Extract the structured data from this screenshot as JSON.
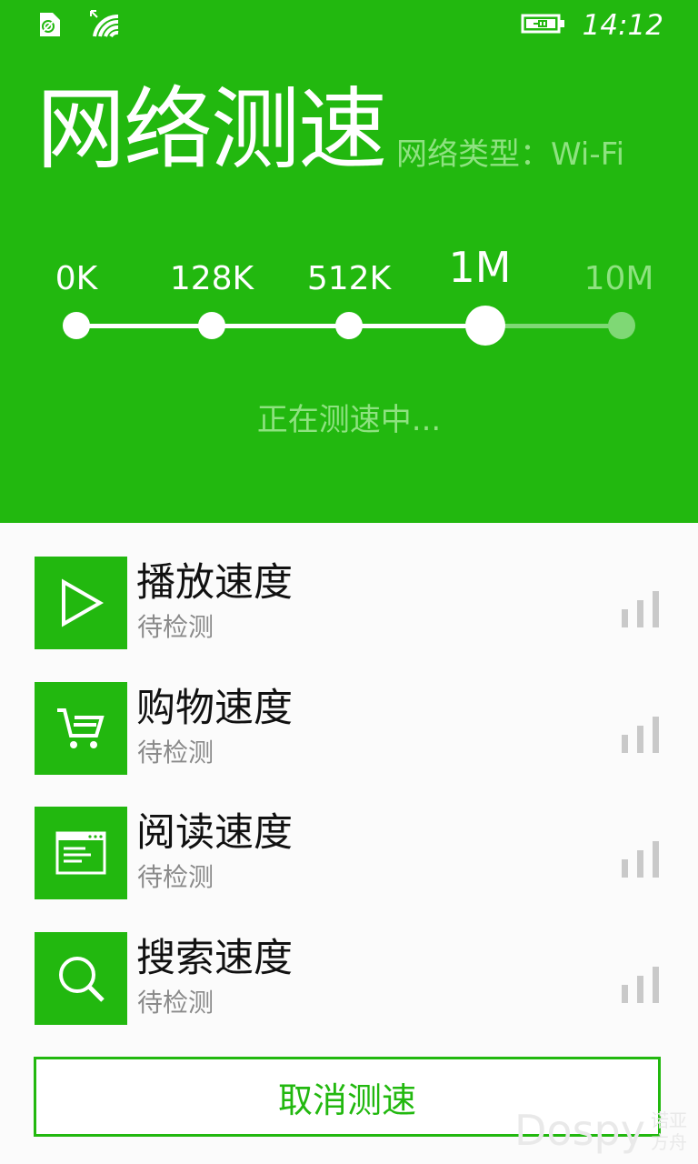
{
  "status_bar": {
    "time": "14:12"
  },
  "header": {
    "title": "网络测速",
    "network_type": "网络类型：Wi-Fi"
  },
  "speed_scale": {
    "labels": [
      "0K",
      "128K",
      "512K",
      "1M",
      "10M"
    ],
    "current_index": 3
  },
  "status_text": "正在测速中...",
  "tests": [
    {
      "name": "播放速度",
      "state": "待检测",
      "icon": "play-icon"
    },
    {
      "name": "购物速度",
      "state": "待检测",
      "icon": "cart-icon"
    },
    {
      "name": "阅读速度",
      "state": "待检测",
      "icon": "browser-window-icon"
    },
    {
      "name": "搜索速度",
      "state": "待检测",
      "icon": "search-icon"
    }
  ],
  "cancel_button": "取消测速",
  "watermark": {
    "brand": "Dospy",
    "sub": "诺亚方舟"
  },
  "colors": {
    "accent": "#22b80f",
    "pending": "#7fd875",
    "bar_idle": "#c9c9c9"
  }
}
